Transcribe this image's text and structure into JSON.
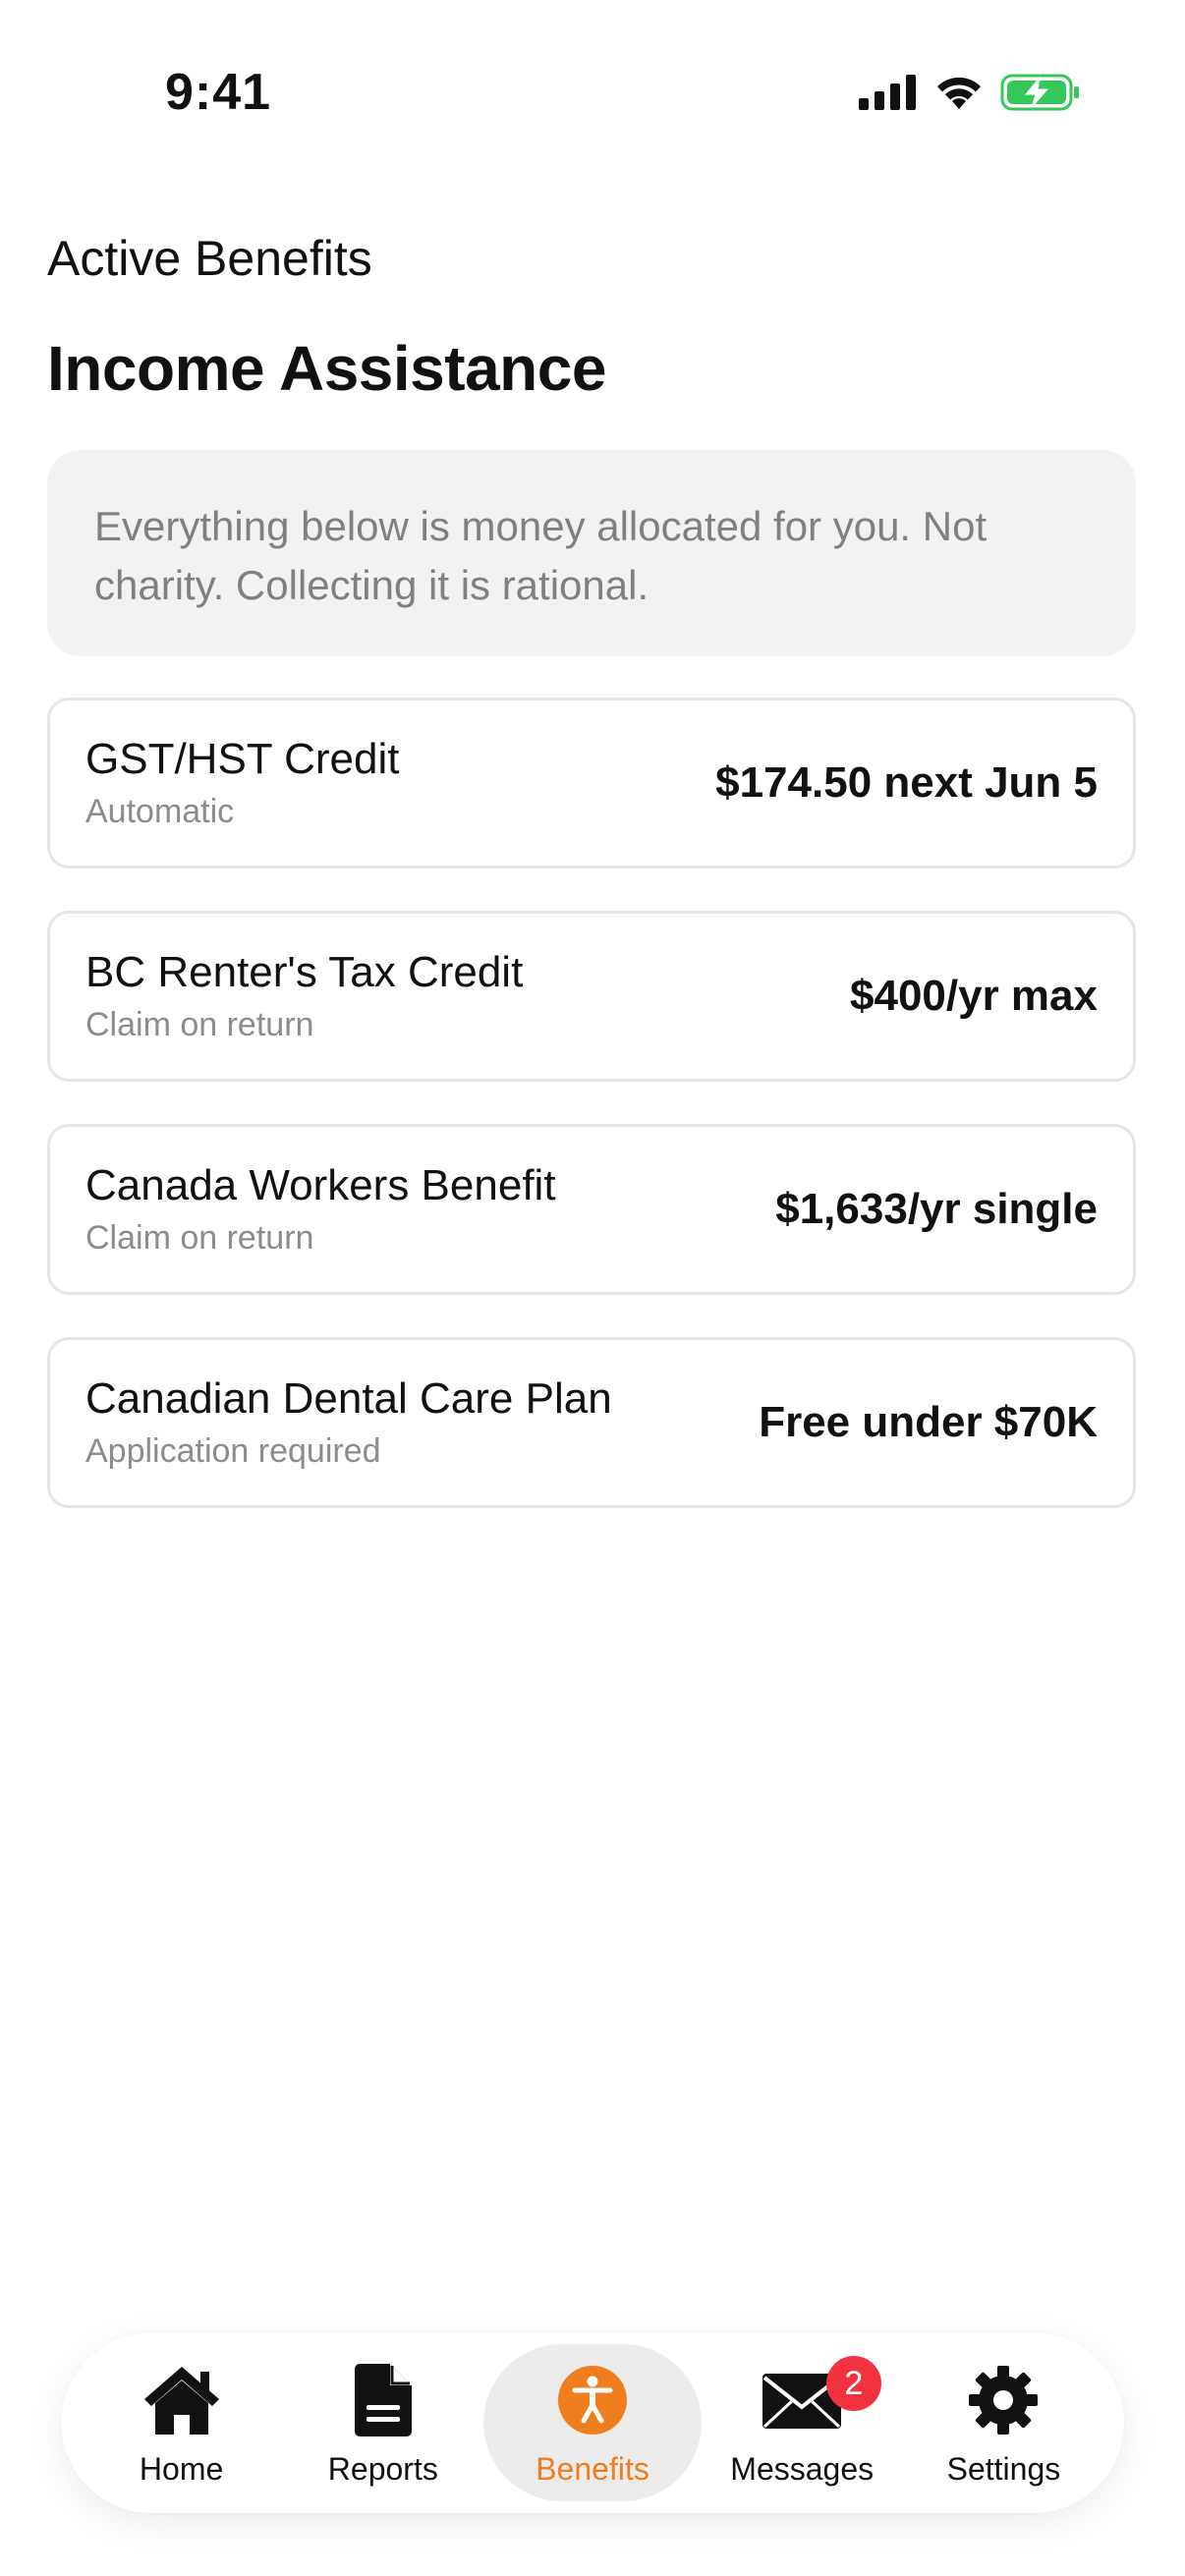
{
  "status": {
    "time": "9:41",
    "icons": [
      "signal-icon",
      "wifi-icon",
      "battery-charging-icon"
    ],
    "battery_color": "#34c759"
  },
  "header": {
    "section_label": "Active Benefits",
    "title": "Income Assistance"
  },
  "note": {
    "text": "Everything below is money allocated for you. Not charity. Collecting it is rational."
  },
  "benefits": [
    {
      "name": "GST/HST Credit",
      "subtitle": "Automatic",
      "amount": "$174.50 next Jun 5"
    },
    {
      "name": "BC Renter's Tax Credit",
      "subtitle": "Claim on return",
      "amount": "$400/yr max"
    },
    {
      "name": "Canada Workers Benefit",
      "subtitle": "Claim on return",
      "amount": "$1,633/yr single"
    },
    {
      "name": "Canadian Dental Care Plan",
      "subtitle": "Application required",
      "amount": "Free under $70K"
    }
  ],
  "tabs": [
    {
      "label": "Home",
      "icon": "home-icon"
    },
    {
      "label": "Reports",
      "icon": "document-icon"
    },
    {
      "label": "Benefits",
      "icon": "accessibility-icon",
      "active": true
    },
    {
      "label": "Messages",
      "icon": "envelope-icon",
      "badge": "2"
    },
    {
      "label": "Settings",
      "icon": "gear-icon"
    }
  ],
  "colors": {
    "accent": "#f07e1e",
    "badge": "#f2323f",
    "note_bg": "#f2f2f2"
  }
}
